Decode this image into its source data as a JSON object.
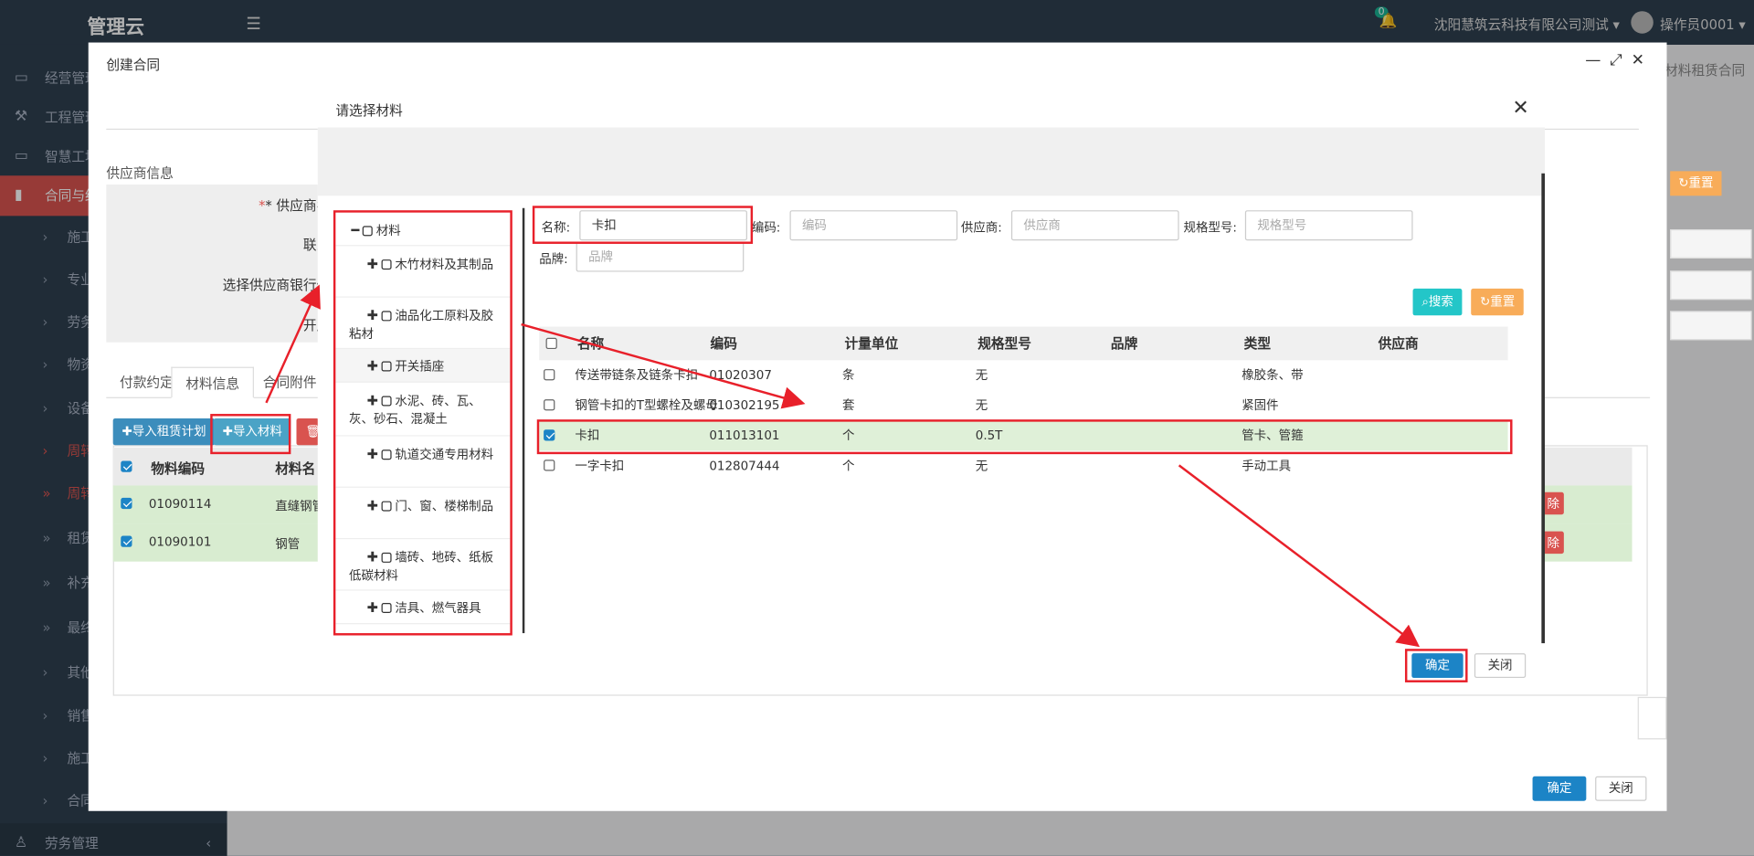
{
  "app": {
    "logo": "管理云",
    "company": "沈阳慧筑云科技有限公司测试",
    "user": "操作员0001",
    "notif_count": "0",
    "right_tab": "材料租赁合同"
  },
  "sidebar": {
    "main_items": [
      {
        "label": "经营管理"
      },
      {
        "label": "工程管理"
      },
      {
        "label": "智慧工地"
      },
      {
        "label": "合同与结算"
      }
    ],
    "sub_items": [
      {
        "label": "施工"
      },
      {
        "label": "专业"
      },
      {
        "label": "劳务"
      },
      {
        "label": "物资"
      },
      {
        "label": "设备"
      },
      {
        "label": "周转"
      },
      {
        "label": "周转"
      },
      {
        "label": "租赁"
      },
      {
        "label": "补充"
      },
      {
        "label": "最终"
      },
      {
        "label": "其他"
      },
      {
        "label": "销售"
      },
      {
        "label": "施工"
      },
      {
        "label": "合同"
      }
    ],
    "bottom_item": "劳务管理"
  },
  "outer_modal": {
    "title": "创建合同",
    "section_title": "供应商信息",
    "form_labels": [
      "* 供应商名",
      "联系",
      "选择供应商银行信",
      "开户"
    ],
    "tabs": [
      "付款约定",
      "材料信息",
      "合同附件"
    ],
    "buttons": {
      "import_plan": "✚导入租赁计划",
      "import_material": "✚导入材料",
      "delete": "🗑删"
    },
    "table": {
      "col_code": "物料编码",
      "col_name": "材料名",
      "rows": [
        {
          "code": "01090114",
          "name": "直缝钢管"
        },
        {
          "code": "01090101",
          "name": "钢管"
        }
      ]
    },
    "del_label": "除",
    "reset_label": "重置",
    "ok": "确定",
    "close": "关闭"
  },
  "inner_modal": {
    "title": "请选择材料",
    "tree": [
      {
        "label": "材料",
        "expanded": true
      },
      {
        "label": "木竹材料及其制品"
      },
      {
        "label": "油品化工原料及胶粘材"
      },
      {
        "label": "开关插座"
      },
      {
        "label": "水泥、砖、瓦、灰、砂石、混凝土"
      },
      {
        "label": "轨道交通专用材料"
      },
      {
        "label": "门、窗、楼梯制品"
      },
      {
        "label": "墙砖、地砖、纸板低碳材料"
      },
      {
        "label": "洁具、燃气器具"
      }
    ],
    "filters": {
      "name_label": "名称:",
      "name_value": "卡扣",
      "code_label": "编码:",
      "code_placeholder": "编码",
      "supplier_label": "供应商:",
      "supplier_placeholder": "供应商",
      "spec_label": "规格型号:",
      "spec_placeholder": "规格型号",
      "brand_label": "品牌:",
      "brand_placeholder": "品牌"
    },
    "search_btn": "搜索",
    "reset_btn": "重置",
    "columns": [
      "名称",
      "编码",
      "计量单位",
      "规格型号",
      "品牌",
      "类型",
      "供应商"
    ],
    "rows": [
      {
        "name": "传送带链条及链条卡扣",
        "code": "01020307",
        "unit": "条",
        "spec": "无",
        "brand": "",
        "type": "橡胶条、带",
        "supplier": "",
        "checked": false
      },
      {
        "name": "钢管卡扣的T型螺栓及螺母",
        "code": "010302195",
        "unit": "套",
        "spec": "无",
        "brand": "",
        "type": "紧固件",
        "supplier": "",
        "checked": false
      },
      {
        "name": "卡扣",
        "code": "011013101",
        "unit": "个",
        "spec": "0.5T",
        "brand": "",
        "type": "管卡、管箍",
        "supplier": "",
        "checked": true
      },
      {
        "name": "一字卡扣",
        "code": "012807444",
        "unit": "个",
        "spec": "无",
        "brand": "",
        "type": "手动工具",
        "supplier": "",
        "checked": false
      }
    ],
    "ok": "确定",
    "close": "关闭"
  },
  "colors": {
    "accent": "#1c84c6",
    "sidebar": "#2f4050",
    "active": "#d9534f",
    "annotation": "#e8202a",
    "selected_row": "#dff0d8"
  }
}
